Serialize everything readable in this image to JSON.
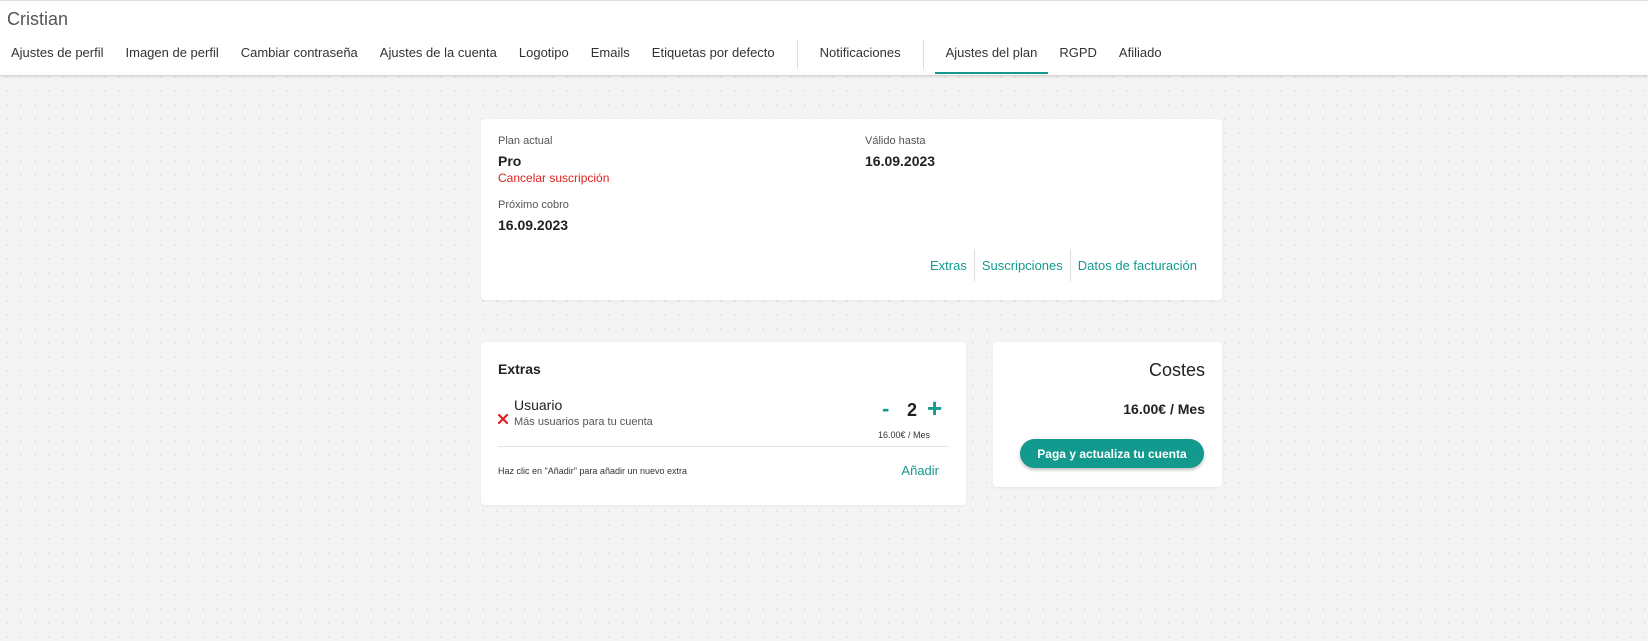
{
  "header": {
    "user_name": "Cristian",
    "tabs": [
      {
        "label": "Ajustes de perfil"
      },
      {
        "label": "Imagen de perfil"
      },
      {
        "label": "Cambiar contraseña"
      },
      {
        "label": "Ajustes de la cuenta"
      },
      {
        "label": "Logotipo"
      },
      {
        "label": "Emails"
      },
      {
        "label": "Etiquetas por defecto"
      },
      {
        "label": "Notificaciones"
      },
      {
        "label": "Ajustes del plan"
      },
      {
        "label": "RGPD"
      },
      {
        "label": "Afiliado"
      }
    ],
    "active_tab": "Ajustes del plan"
  },
  "plan": {
    "current_label": "Plan actual",
    "current_value": "Pro",
    "cancel_label": "Cancelar suscripción",
    "next_charge_label": "Próximo cobro",
    "next_charge_value": "16.09.2023",
    "valid_until_label": "Válido hasta",
    "valid_until_value": "16.09.2023",
    "links": {
      "extras": "Extras",
      "subscriptions": "Suscripciones",
      "billing": "Datos de facturación"
    }
  },
  "extras": {
    "title": "Extras",
    "item": {
      "name": "Usuario",
      "description": "Más usuarios para tu cuenta",
      "minus": "-",
      "quantity": "2",
      "plus": "+",
      "price": "16.00€ / Mes"
    },
    "hint": "Haz clic en \"Añadir\" para añadir un nuevo extra",
    "add_label": "Añadir"
  },
  "costs": {
    "title": "Costes",
    "amount": "16.00€ / Mes",
    "pay_button": "Paga y actualiza tu cuenta"
  },
  "colors": {
    "accent": "#139a8e",
    "danger": "#e02020",
    "page_background": "#f4f4f4"
  },
  "icons": {
    "remove": "close-icon"
  }
}
